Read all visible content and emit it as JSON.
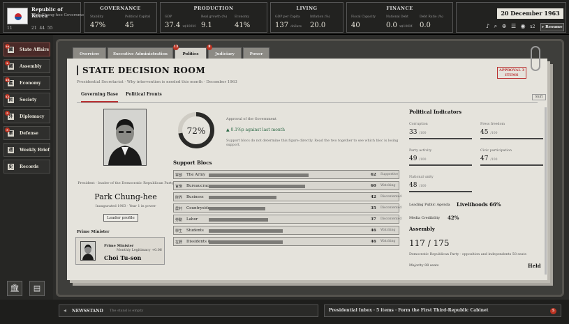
{
  "country": {
    "name": "Republic of Korea",
    "government": "Park Chung-hee Government",
    "level": "11",
    "stats": [
      "21",
      "44",
      "55"
    ]
  },
  "panels": {
    "governance": {
      "title": "GOVERNANCE",
      "stats": [
        {
          "label": "Stability",
          "value": "47%"
        },
        {
          "label": "Political Capital",
          "value": "45"
        }
      ]
    },
    "production": {
      "title": "PRODUCTION",
      "stats": [
        {
          "label": "GDP",
          "value": "37.4",
          "unit": "x$100M"
        },
        {
          "label": "Real growth (%)",
          "value": "9.1"
        },
        {
          "label": "Economy",
          "value": "41%"
        }
      ]
    },
    "living": {
      "title": "LIVING",
      "stats": [
        {
          "label": "GDP per Capita",
          "value": "137",
          "unit": "dollars"
        },
        {
          "label": "Inflation (%)",
          "value": "20.0"
        }
      ]
    },
    "finance": {
      "title": "FINANCE",
      "stats": [
        {
          "label": "Fiscal Capacity",
          "value": "40"
        },
        {
          "label": "National Debt",
          "value": "0.0",
          "unit": "x$100M"
        },
        {
          "label": "Debt Ratio (%)",
          "value": "0.0"
        }
      ]
    }
  },
  "date": "20 December 1963",
  "controls": {
    "music": "♪",
    "search": "⌕",
    "add": "⊕",
    "menu": "☰",
    "pause": "◉",
    "speed": "x2",
    "resume": "▸ Resume"
  },
  "sidebar": [
    {
      "label": "State Affairs",
      "badge": "16",
      "icon": "國"
    },
    {
      "label": "Assembly",
      "badge": "2",
      "icon": "國"
    },
    {
      "label": "Economy",
      "badge": "10",
      "icon": "產"
    },
    {
      "label": "Society",
      "badge": "12",
      "icon": "民"
    },
    {
      "label": "Diplomacy",
      "badge": "5",
      "icon": "外"
    },
    {
      "label": "Defense",
      "badge": "5",
      "icon": "軍"
    },
    {
      "label": "Weekly Brief",
      "badge": "",
      "icon": "週"
    },
    {
      "label": "Records",
      "badge": "",
      "icon": "史"
    }
  ],
  "tabs": [
    {
      "label": "Overview",
      "badge": ""
    },
    {
      "label": "Executive Administration",
      "badge": ""
    },
    {
      "label": "Politics",
      "badge": "13"
    },
    {
      "label": "Judiciary",
      "badge": "8"
    },
    {
      "label": "Power",
      "badge": ""
    }
  ],
  "page": {
    "title": "STATE DECISION ROOM",
    "subtitle": "Presidential Secretariat · Why intervention is needed this month · December 1963",
    "approval_badge": "APPROVAL 3 ITEMS",
    "subtabs": [
      "Governing Base",
      "Political Fronts"
    ],
    "shift": "Shift"
  },
  "leader": {
    "desc": "President · leader of the Democratic Republican Party",
    "name": "Park Chung-hee",
    "since": "Inaugurated 1963 · Year 1 in power",
    "profile_btn": "Leader profile"
  },
  "prime_minister": {
    "section": "Prime Minister",
    "title": "Prime Minister",
    "legitimacy": "Monthly Legitimacy +0.06",
    "name": "Choi Tu-son"
  },
  "approval": {
    "value": "72%",
    "fraction": 0.72,
    "label": "Approval of the Government",
    "change": "▲ 0.1%p against last month",
    "note": "Support blocs do not determine this figure directly. Read the two together to see which bloc is losing support."
  },
  "blocs": {
    "title": "Support Blocs",
    "items": [
      {
        "icon": "軍部",
        "name": "The Army",
        "value": 62,
        "status": "Supportive"
      },
      {
        "icon": "官僚",
        "name": "Bureaucracy",
        "value": 60,
        "status": "Watching"
      },
      {
        "icon": "財界",
        "name": "Business",
        "value": 42,
        "status": "Discontented"
      },
      {
        "icon": "農村",
        "name": "Countryside",
        "value": 35,
        "status": "Discontented"
      },
      {
        "icon": "勞動",
        "name": "Labor",
        "value": 37,
        "status": "Discontented"
      },
      {
        "icon": "學生",
        "name": "Students",
        "value": 46,
        "status": "Watching"
      },
      {
        "icon": "在野",
        "name": "Dissidents &",
        "value": 46,
        "status": "Watching"
      }
    ]
  },
  "indicators": {
    "title": "Political Indicators",
    "items": [
      {
        "label": "Corruption",
        "value": "33",
        "max": "/100"
      },
      {
        "label": "Press freedom",
        "value": "45",
        "max": "/100"
      },
      {
        "label": "Party activity",
        "value": "49",
        "max": "/100"
      },
      {
        "label": "Civic participation",
        "value": "47",
        "max": "/100"
      },
      {
        "label": "National unity",
        "value": "48",
        "max": "/100"
      }
    ],
    "agenda_label": "Leading Public Agenda",
    "agenda_value": "Livelihoods 66%",
    "cred_label": "Media Credibility",
    "cred_value": "42%"
  },
  "assembly": {
    "title": "Assembly",
    "value": "117 / 175",
    "note": "Democratic Republican Party · opposition and independents 58 seats",
    "majority": "Majority 88 seats",
    "status": "Held"
  },
  "bottom": {
    "newsstand": "NEWSSTAND",
    "news_text": "The stand is empty",
    "inbox": "Presidential Inbox · 5 items · Form the First Third-Republic Cabinet",
    "inbox_badge": "5"
  }
}
